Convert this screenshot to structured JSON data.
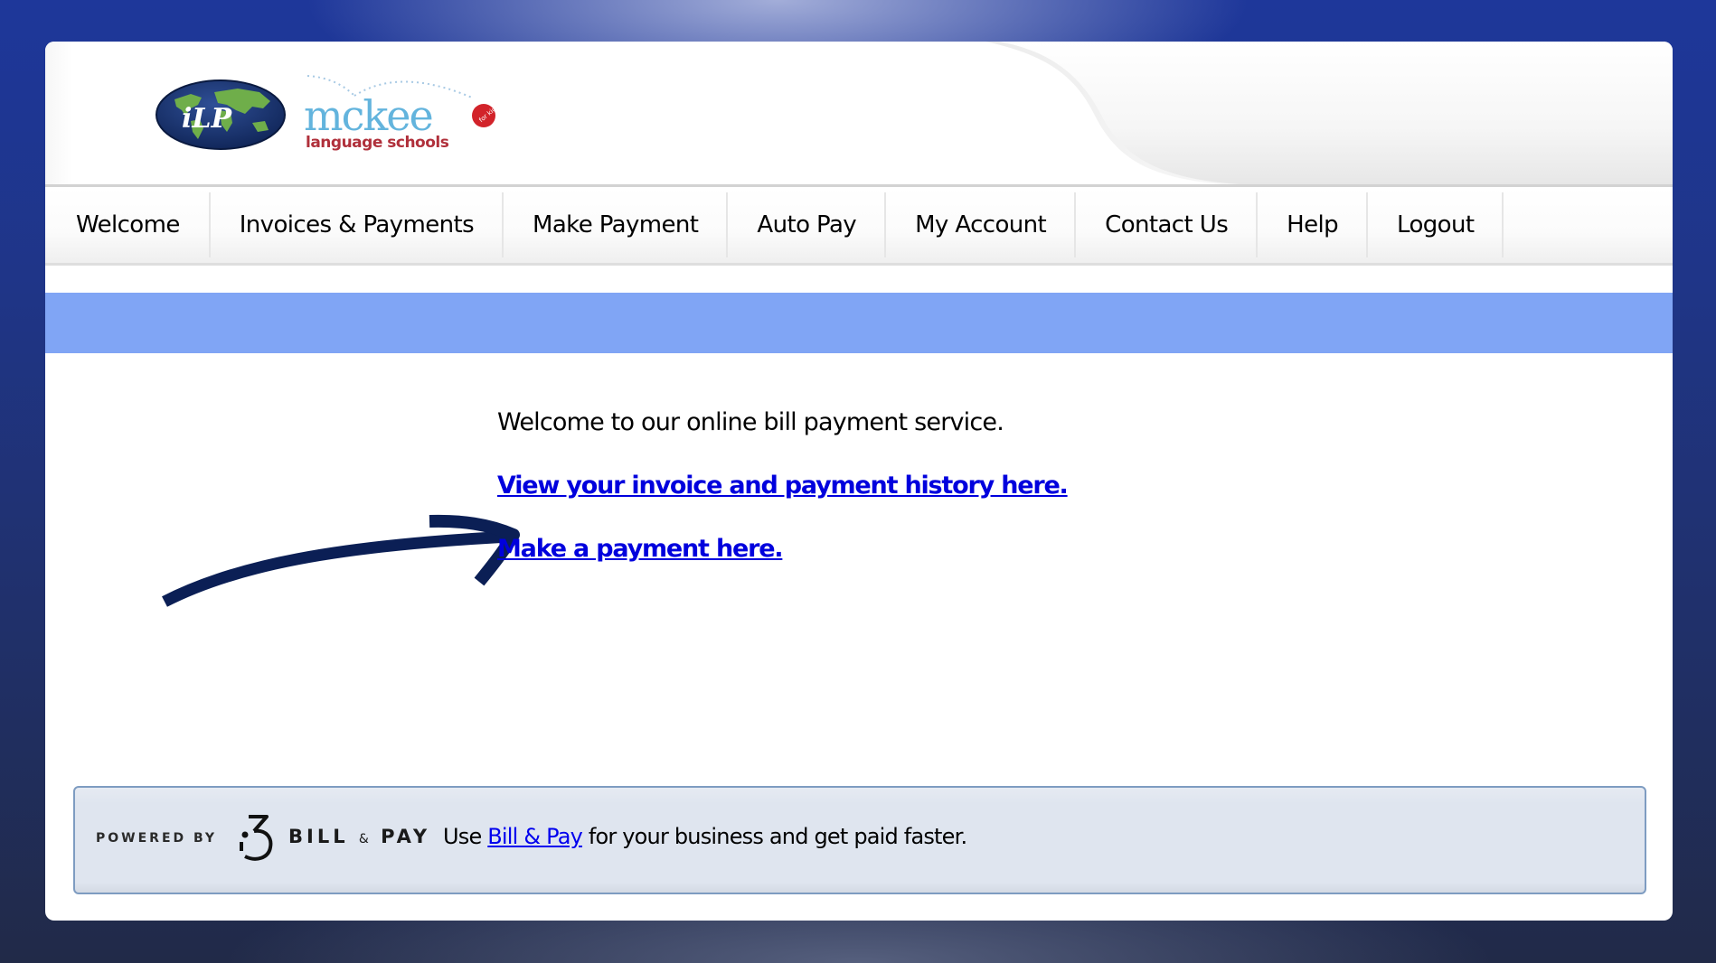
{
  "header": {
    "logos": [
      {
        "name": "ILP",
        "text": "iLP"
      },
      {
        "name": "McKee Language Schools",
        "text": "mckee",
        "subtitle": "language schools",
        "badge": "for kids"
      }
    ]
  },
  "nav": {
    "items": [
      {
        "label": "Welcome"
      },
      {
        "label": "Invoices & Payments"
      },
      {
        "label": "Make Payment"
      },
      {
        "label": "Auto Pay"
      },
      {
        "label": "My Account"
      },
      {
        "label": "Contact Us"
      },
      {
        "label": "Help"
      },
      {
        "label": "Logout"
      }
    ]
  },
  "main": {
    "welcome_text": "Welcome to our online bill payment service.",
    "links": [
      {
        "label": "View your invoice and payment history here."
      },
      {
        "label": "Make a payment here."
      }
    ],
    "arrow_icon": "curved-arrow-right-icon"
  },
  "footer": {
    "powered_by": "POWERED BY",
    "brand_name": "BILL",
    "brand_amp": "&",
    "brand_name2": "PAY",
    "text_before": "Use ",
    "link_label": "Bill & Pay",
    "text_after": " for your business and get paid faster."
  },
  "colors": {
    "band": "#80a5f5",
    "link": "#0000dd",
    "arrow": "#0b1f55",
    "footer_border": "#7e9cc1"
  }
}
